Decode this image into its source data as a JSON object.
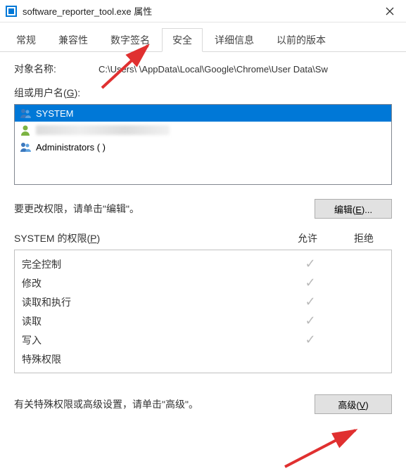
{
  "titlebar": {
    "title": "software_reporter_tool.exe 属性"
  },
  "tabs": [
    {
      "label": "常规"
    },
    {
      "label": "兼容性"
    },
    {
      "label": "数字签名"
    },
    {
      "label": "安全"
    },
    {
      "label": "详细信息"
    },
    {
      "label": "以前的版本"
    }
  ],
  "active_tab_index": 3,
  "object_name": {
    "label": "对象名称:",
    "value": "C:\\Users\\      \\AppData\\Local\\Google\\Chrome\\User Data\\Sw"
  },
  "group_users": {
    "label": "组或用户名(G):",
    "items": [
      {
        "name": "SYSTEM"
      },
      {
        "name": ""
      },
      {
        "name": "Administrators (                                                           )"
      }
    ],
    "selected_index": 0
  },
  "edit_hint": "要更改权限，请单击\"编辑\"。",
  "edit_button": "编辑(E)...",
  "permissions": {
    "header": {
      "title": "SYSTEM 的权限(P)",
      "allow": "允许",
      "deny": "拒绝"
    },
    "rows": [
      {
        "name": "完全控制",
        "allow": true,
        "deny": false
      },
      {
        "name": "修改",
        "allow": true,
        "deny": false
      },
      {
        "name": "读取和执行",
        "allow": true,
        "deny": false
      },
      {
        "name": "读取",
        "allow": true,
        "deny": false
      },
      {
        "name": "写入",
        "allow": true,
        "deny": false
      },
      {
        "name": "特殊权限",
        "allow": false,
        "deny": false
      }
    ]
  },
  "advanced_hint": "有关特殊权限或高级设置，请单击\"高级\"。",
  "advanced_button": "高级(V)"
}
